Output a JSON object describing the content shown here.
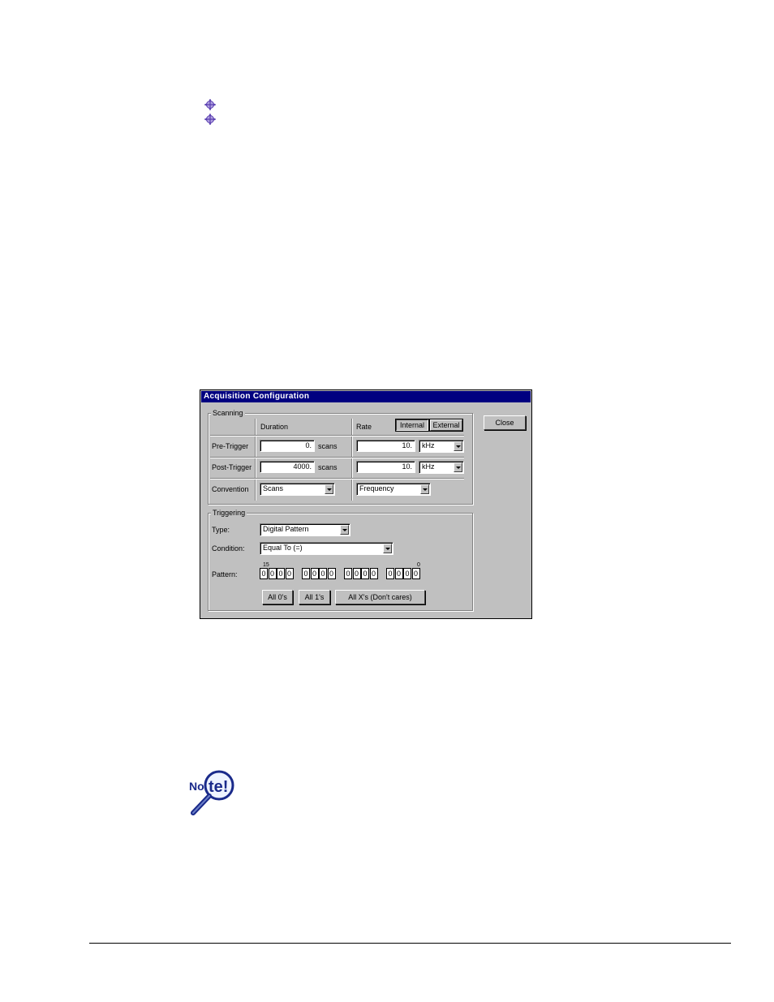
{
  "bullets": [
    "bullet-1",
    "bullet-2"
  ],
  "dialog": {
    "title": "Acquisition Configuration",
    "close_label": "Close",
    "scanning": {
      "group_label": "Scanning",
      "col_duration": "Duration",
      "col_rate": "Rate",
      "clock_internal": "Internal",
      "clock_external": "External",
      "pre_trigger_label": "Pre-Trigger",
      "pre_trigger_value": "0.",
      "pre_trigger_unit": "scans",
      "pre_rate_value": "10.",
      "pre_rate_unit": "kHz",
      "post_trigger_label": "Post-Trigger",
      "post_trigger_value": "4000.",
      "post_trigger_unit": "scans",
      "post_rate_value": "10.",
      "post_rate_unit": "kHz",
      "convention_label": "Convention",
      "convention_duration": "Scans",
      "convention_rate": "Frequency"
    },
    "triggering": {
      "group_label": "Triggering",
      "type_label": "Type:",
      "type_value": "Digital Pattern",
      "condition_label": "Condition:",
      "condition_value": "Equal To (=)",
      "pattern_label": "Pattern:",
      "bit_high": "15",
      "bit_low": "0",
      "bits": [
        "0",
        "0",
        "0",
        "0",
        "0",
        "0",
        "0",
        "0",
        "0",
        "0",
        "0",
        "0",
        "0",
        "0",
        "0",
        "0"
      ],
      "all0_label": "All 0's",
      "all1_label": "All 1's",
      "allx_label": "All X's (Don't cares)"
    }
  },
  "note_icon": "note-magnifier-icon",
  "colors": {
    "title_bar": "#000080",
    "dialog_face": "#c0c0c0"
  }
}
